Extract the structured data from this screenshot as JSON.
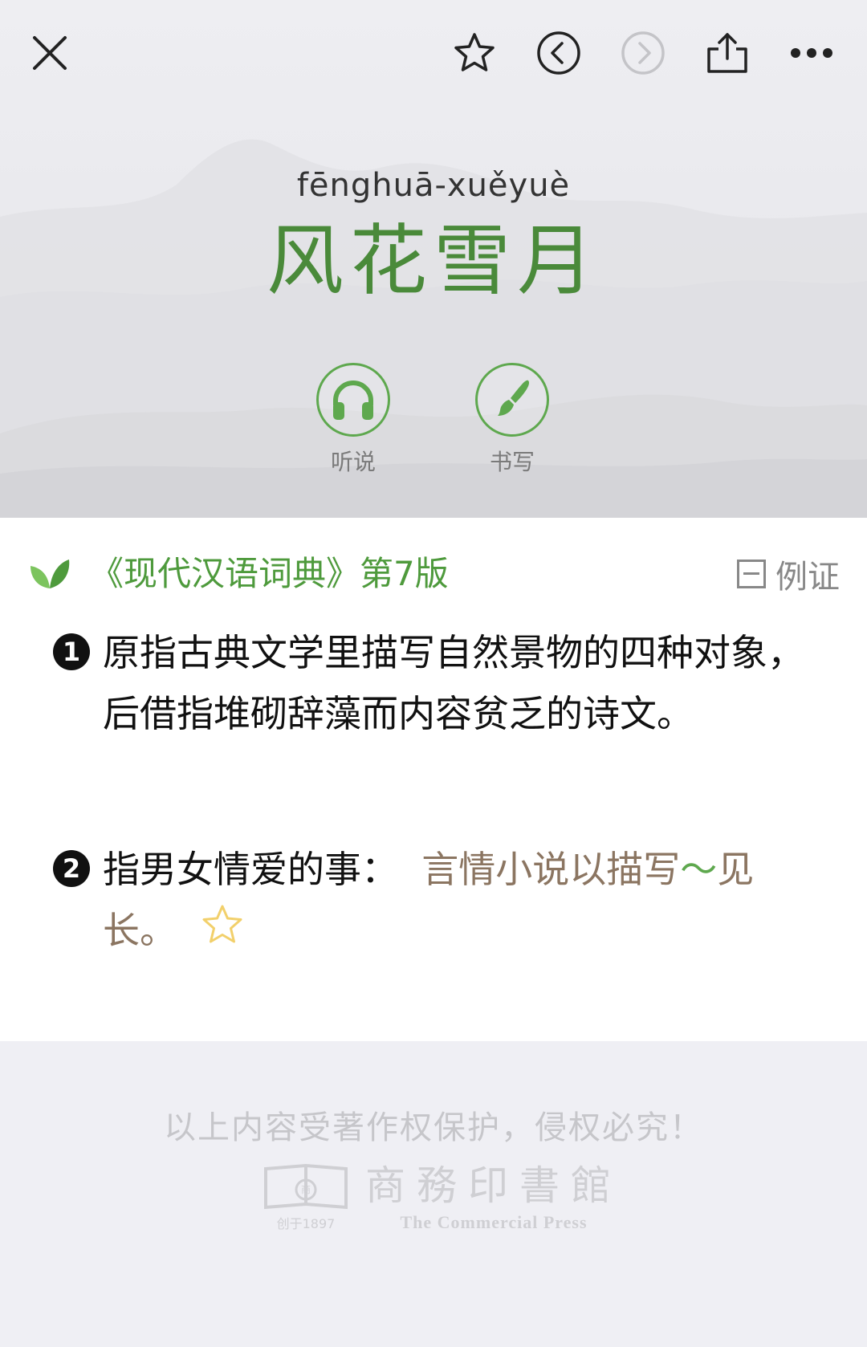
{
  "topbar": {
    "close_icon": "close-icon",
    "favorite_icon": "star-outline-icon",
    "back_icon": "chevron-left-circle-icon",
    "forward_icon": "chevron-right-circle-icon",
    "share_icon": "share-icon",
    "more_icon": "more-dots-icon"
  },
  "entry": {
    "pinyin": "fēnghuā-xuěyuè",
    "headword": "风花雪月"
  },
  "actions": [
    {
      "label": "听说",
      "icon": "headphones-icon"
    },
    {
      "label": "书写",
      "icon": "brush-icon"
    }
  ],
  "source": {
    "title": "《现代汉语词典》第7版",
    "examples_label": "例证"
  },
  "definitions": [
    {
      "number": "1",
      "text": "原指古典文学里描写自然景物的四种对象，后借指堆砌辞藻而内容贫乏的诗文。"
    },
    {
      "number": "2",
      "text": "指男女情爱的事：",
      "example_before": "言情小说以描写",
      "example_tilde": "～",
      "example_after": "见长。"
    }
  ],
  "footer": {
    "copyright": "以上内容受著作权保护，侵权必究！",
    "publisher_cn": "商務印書館",
    "publisher_en": "The Commercial Press",
    "founded": "创于1897"
  },
  "colors": {
    "accent_green": "#4e9a3c",
    "example_brown": "#8b7561",
    "star_yellow": "#f2d06b",
    "background": "#efeff4"
  }
}
